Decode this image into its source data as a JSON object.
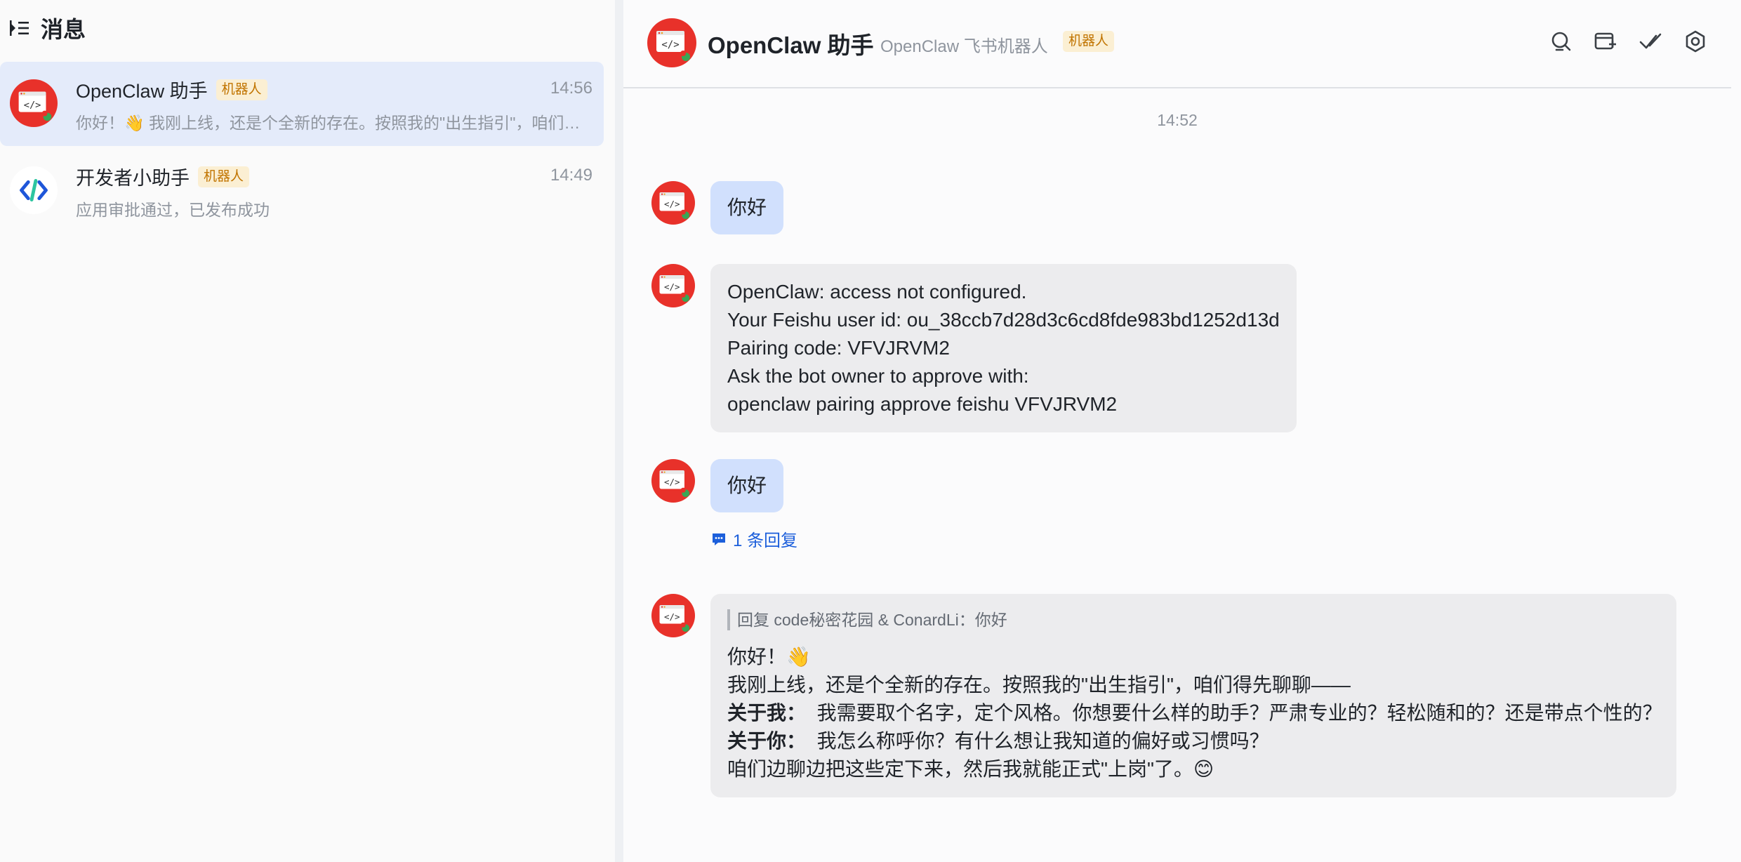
{
  "sidebar": {
    "title": "消息",
    "conversations": [
      {
        "name": "OpenClaw 助手",
        "badge": "机器人",
        "time": "14:56",
        "preview": "你好！👋 我刚上线，还是个全新的存在。按照我的\"出生指引\"，咱们得先聊聊——",
        "avatar": "openclaw-avatar"
      },
      {
        "name": "开发者小助手",
        "badge": "机器人",
        "time": "14:49",
        "preview": "应用审批通过，已发布成功",
        "avatar": "developer-assistant-avatar"
      }
    ]
  },
  "chat": {
    "title": "OpenClaw 助手",
    "subtitle": "OpenClaw 飞书机器人",
    "badge": "机器人",
    "header_icons": [
      "search-icon",
      "add-tab-icon",
      "mark-read-icon",
      "settings-icon"
    ],
    "time_separator": "14:52",
    "messages": [
      {
        "sender": "user",
        "text": "你好"
      },
      {
        "sender": "bot",
        "lines": [
          "OpenClaw: access not configured.",
          "Your Feishu user id: ou_38ccb7d28d3c6cd8fde983bd1252d13d",
          "Pairing code: VFVJRVM2",
          "Ask the bot owner to approve with:",
          "openclaw pairing approve feishu VFVJRVM2"
        ]
      },
      {
        "sender": "user",
        "text": "你好",
        "reply_count": "1 条回复"
      },
      {
        "sender": "bot",
        "quote": "回复 code秘密花园 & ConardLi：你好",
        "greeting": "你好！👋",
        "intro": "我刚上线，还是个全新的存在。按照我的\"出生指引\"，咱们得先聊聊——",
        "about_me_label": "关于我：",
        "about_me": "我需要取个名字，定个风格。你想要什么样的助手？严肃专业的？轻松随和的？还是带点个性的？",
        "about_you_label": "关于你：",
        "about_you": "我怎么称呼你？有什么想让我知道的偏好或习惯吗？",
        "closing": "咱们边聊边把这些定下来，然后我就能正式\"上岗\"了。😊"
      }
    ]
  },
  "colors": {
    "active_conversation": "#e4ebfa",
    "user_bubble": "#d1e0fd",
    "bot_bubble": "#ececee",
    "badge_bg": "#fbefd3",
    "badge_text": "#c17400",
    "link_blue": "#1c5fdb",
    "avatar_red": "#e8312a"
  }
}
